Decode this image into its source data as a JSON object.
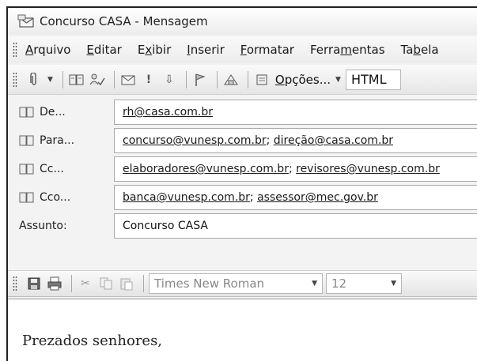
{
  "window": {
    "title": "Concurso CASA - Mensagem"
  },
  "menu": {
    "items": [
      {
        "pre": "",
        "u": "A",
        "post": "rquivo"
      },
      {
        "pre": "",
        "u": "E",
        "post": "ditar"
      },
      {
        "pre": "E",
        "u": "x",
        "post": "ibir"
      },
      {
        "pre": "",
        "u": "I",
        "post": "nserir"
      },
      {
        "pre": "",
        "u": "F",
        "post": "ormatar"
      },
      {
        "pre": "Ferra",
        "u": "m",
        "post": "entas"
      },
      {
        "pre": "Ta",
        "u": "b",
        "post": "ela"
      }
    ]
  },
  "toolbar": {
    "options_u": "O",
    "options_rest": "pções...",
    "format_value": "HTML"
  },
  "header_fields": {
    "from": {
      "label": "De...",
      "values": [
        "rh@casa.com.br"
      ]
    },
    "to": {
      "label": "Para...",
      "values": [
        "concurso@vunesp.com.br",
        "direção@casa.com.br"
      ]
    },
    "cc": {
      "label": "Cc...",
      "values": [
        "elaboradores@vunesp.com.br",
        "revisores@vunesp.com.br"
      ]
    },
    "bcc": {
      "label": "Cco...",
      "values": [
        "banca@vunesp.com.br",
        "assessor@mec.gov.br"
      ]
    },
    "subject": {
      "label": "Assunto:",
      "value": "Concurso CASA"
    }
  },
  "format_toolbar": {
    "font_name": "Times New Roman",
    "font_size": "12"
  },
  "body": {
    "text": "Prezados senhores,"
  },
  "icons": {
    "app": "message-icon",
    "address_book": "address-book-icon",
    "colors": {
      "border": "#222222",
      "field_border": "#a9a9a9"
    }
  }
}
